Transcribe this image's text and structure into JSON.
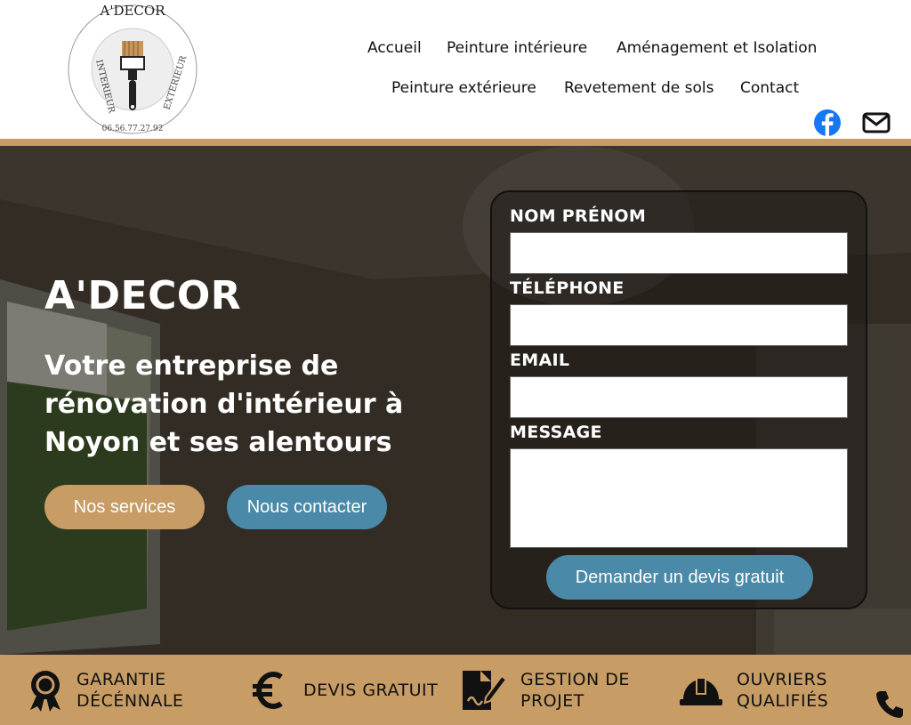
{
  "logo": {
    "brand": "A'DECOR",
    "ring_left": "INTERIEUR",
    "ring_right": "EXTERIEUR",
    "phone": "06.56.77.27.92"
  },
  "nav": {
    "items": [
      "Accueil",
      "Peinture intérieure",
      "Aménagement et Isolation",
      "Peinture extérieure",
      "Revetement de sols",
      "Contact"
    ]
  },
  "social": [
    "facebook-icon",
    "mail-icon"
  ],
  "hero": {
    "title": "A'DECOR",
    "subtitle": "Votre entreprise de rénovation d'intérieur à Noyon et ses alentours",
    "btn_services": "Nos services",
    "btn_contact": "Nous contacter"
  },
  "form": {
    "name_label": "NOM PRÉNOM",
    "phone_label": "TÉLÉPHONE",
    "email_label": "EMAIL",
    "message_label": "MESSAGE",
    "name_value": "",
    "phone_value": "",
    "email_value": "",
    "message_value": "",
    "submit": "Demander un devis gratuit"
  },
  "features": [
    {
      "icon": "award-ribbon-icon",
      "line1": "GARANTIE",
      "line2": "DÉCÉNNALE"
    },
    {
      "icon": "euro-icon",
      "line1": "DEVIS GRATUIT",
      "line2": ""
    },
    {
      "icon": "document-sign-icon",
      "line1": "GESTION DE",
      "line2": "PROJET"
    },
    {
      "icon": "hard-hat-icon",
      "line1": "OUVRIERS",
      "line2": "QUALIFIÉS"
    }
  ],
  "colors": {
    "accent_tan": "#c79c65",
    "accent_blue": "#4a8aa8",
    "facebook": "#1877f2"
  }
}
